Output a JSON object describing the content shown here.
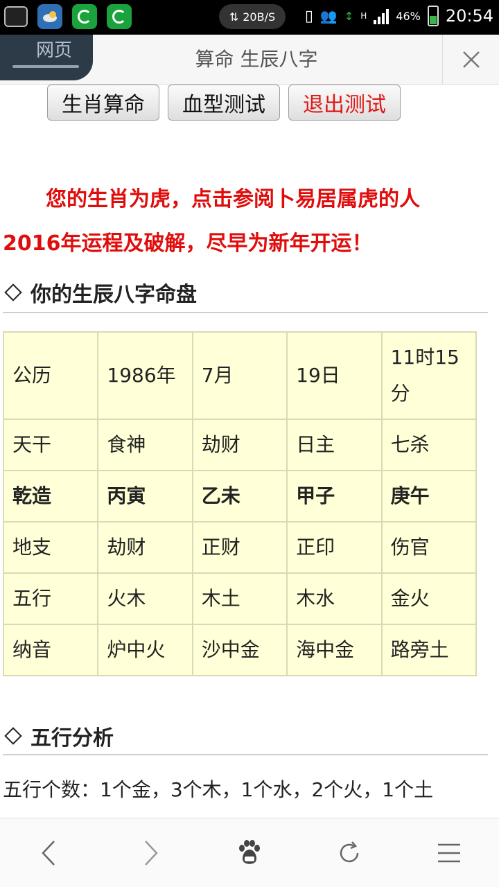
{
  "status_bar": {
    "net_speed": "20B/S",
    "net_type": "H",
    "battery": "46%",
    "battery_level": 0.46,
    "time": "20:54"
  },
  "browser": {
    "tab_label": "网页",
    "page_title": "算命 生辰八字"
  },
  "buttons": {
    "zodiac": "生肖算命",
    "blood": "血型测试",
    "exit": "退出测试"
  },
  "notice": {
    "line1": "您的生肖为虎，点击参阅卜易居属虎的人",
    "line2": "2016年运程及破解，尽早为新年开运！"
  },
  "sections": {
    "bazi_title": "你的生辰八字命盘",
    "wuxing_title": "五行分析"
  },
  "bazi_table": {
    "rows": [
      [
        "公历",
        "1986年",
        "7月",
        "19日",
        "11时15分"
      ],
      [
        "天干",
        "食神",
        "劫财",
        "日主",
        "七杀"
      ],
      [
        "乾造",
        "丙寅",
        "乙未",
        "甲子",
        "庚午"
      ],
      [
        "地支",
        "劫财",
        "正财",
        "正印",
        "伤官"
      ],
      [
        "五行",
        "火木",
        "木土",
        "木水",
        "金火"
      ],
      [
        "纳音",
        "炉中火",
        "沙中金",
        "海中金",
        "路旁土"
      ]
    ]
  },
  "analysis": {
    "text": "五行个数：1个金，3个木，1个水，2个火，1个土"
  }
}
